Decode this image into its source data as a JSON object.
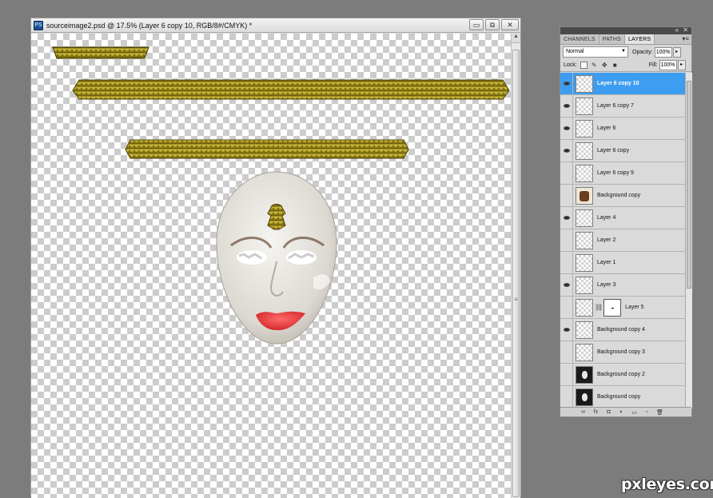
{
  "document": {
    "app_icon": "PS",
    "title": "sourceimage2.psd @ 17.5% (Layer 6 copy 10, RGB/8#/CMYK) *",
    "buttons": {
      "minimize": "▭",
      "restore": "⧉",
      "close": "✕"
    }
  },
  "layers_panel": {
    "controls": {
      "collapse": "«",
      "close": "✕",
      "menu": "▾≡"
    },
    "tabs": [
      {
        "label": "CHANNELS"
      },
      {
        "label": "PATHS"
      },
      {
        "label": "LAYERS",
        "active": true
      }
    ],
    "blend_mode": "Normal",
    "opacity_label": "Opacity:",
    "opacity_value": "100%",
    "lock_label": "Lock:",
    "fill_label": "Fill:",
    "fill_value": "100%",
    "layers": [
      {
        "name": "Layer 6 copy 10",
        "visible": true,
        "selected": true,
        "thumb": "checker"
      },
      {
        "name": "Layer 6 copy 7",
        "visible": true,
        "thumb": "checker"
      },
      {
        "name": "Layer 6",
        "visible": true,
        "thumb": "checker"
      },
      {
        "name": "Layer 6 copy",
        "visible": true,
        "thumb": "checker"
      },
      {
        "name": "Layer 6 copy 9",
        "visible": false,
        "thumb": "checker"
      },
      {
        "name": "Background copy",
        "visible": false,
        "thumb": "warm"
      },
      {
        "name": "Layer 4",
        "visible": true,
        "thumb": "checker"
      },
      {
        "name": "Layer 2",
        "visible": false,
        "thumb": "checker"
      },
      {
        "name": "Layer 1",
        "visible": false,
        "thumb": "checker"
      },
      {
        "name": "Layer 3",
        "visible": true,
        "thumb": "checker"
      },
      {
        "name": "Layer 5",
        "visible": false,
        "thumb": "checker",
        "mask": true
      },
      {
        "name": "Background copy 4",
        "visible": true,
        "thumb": "checker"
      },
      {
        "name": "Background copy 3",
        "visible": false,
        "thumb": "checker"
      },
      {
        "name": "Background copy 2",
        "visible": false,
        "thumb": "dark"
      },
      {
        "name": "Background copy",
        "visible": false,
        "thumb": "dark"
      }
    ]
  },
  "watermark": "pxleyes.com",
  "colors": {
    "selected_row": "#3d9df0",
    "gold": "#b7a524",
    "lips": "#f04a4a"
  }
}
